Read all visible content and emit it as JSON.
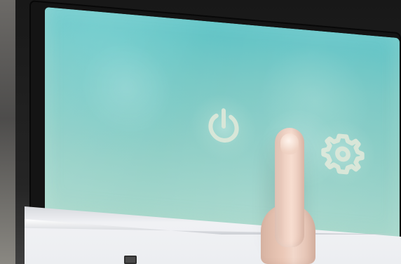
{
  "scene": {
    "icons": {
      "power": "power-icon",
      "settings": "gear-icon"
    },
    "colors": {
      "screen_top": "#58c1c4",
      "screen_bottom": "#a9d8cc",
      "icon": "#d8e6d8",
      "frame": "#181818",
      "skin": "#f0d2c4"
    }
  }
}
